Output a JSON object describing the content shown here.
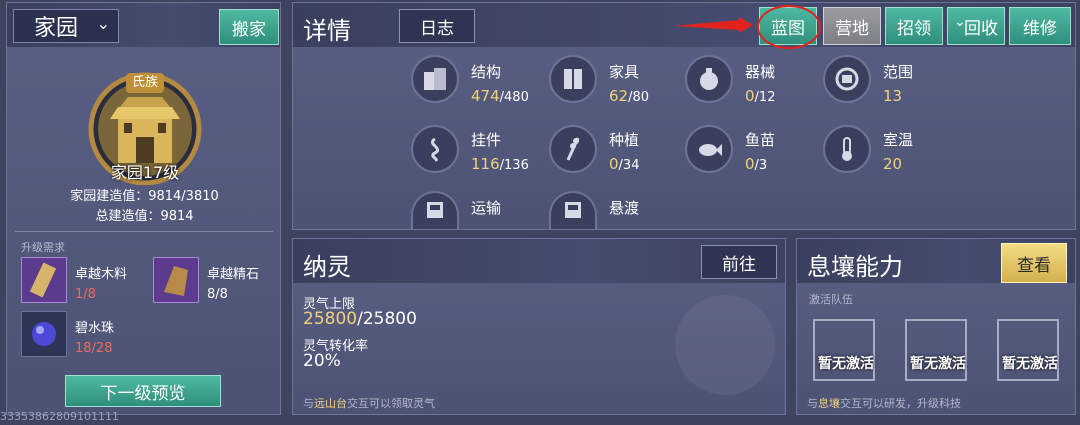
{
  "home": {
    "title": "家园",
    "move_button": "搬家",
    "clan_tag": "氏族",
    "level_label": "家园17级",
    "build_value": "家园建造值：9814/3810",
    "total_build": "总建造值：9814",
    "upgrade_req": "升级需求",
    "materials": [
      {
        "name": "卓越木料",
        "count": "1/8",
        "count_color": "#f06a5a"
      },
      {
        "name": "卓越精石",
        "count": "8/8",
        "count_color": "#ffffff"
      },
      {
        "name": "碧水珠",
        "count": "18/28",
        "count_color": "#f06a5a"
      }
    ],
    "next_preview_button": "下一级预览",
    "footer_digits": "33353862809101111"
  },
  "details": {
    "title": "详情",
    "log_button": "日志",
    "tabs": [
      "蓝图",
      "营地",
      "招领",
      "回收",
      "维修"
    ],
    "stats": [
      {
        "label": "结构",
        "value": "474",
        "total": "/480",
        "icon": "building-icon"
      },
      {
        "label": "家具",
        "value": "62",
        "total": "/80",
        "icon": "wardrobe-icon"
      },
      {
        "label": "器械",
        "value": "0",
        "total": "/12",
        "icon": "machine-icon"
      },
      {
        "label": "范围",
        "value": "13",
        "total": "",
        "icon": "range-icon"
      },
      {
        "label": "挂件",
        "value": "116",
        "total": "/136",
        "icon": "pendant-icon"
      },
      {
        "label": "种植",
        "value": "0",
        "total": "/34",
        "icon": "wheat-icon"
      },
      {
        "label": "鱼苗",
        "value": "0",
        "total": "/3",
        "icon": "fish-icon"
      },
      {
        "label": "室温",
        "value": "20",
        "total": "",
        "icon": "thermometer-icon"
      },
      {
        "label": "运输",
        "value": "",
        "total": "",
        "icon": "train-icon"
      },
      {
        "label": "悬渡",
        "value": "",
        "total": "",
        "icon": "train-icon"
      }
    ]
  },
  "naling": {
    "title": "纳灵",
    "go_button": "前往",
    "cap_label": "灵气上限",
    "cap_current": "25800",
    "cap_total": "/25800",
    "rate_label": "灵气转化率",
    "rate_value": "20%",
    "hint_prefix": "与",
    "hint_place": "远山台",
    "hint_suffix": "交互可以领取灵气"
  },
  "xirang": {
    "title": "息壤能力",
    "view_button": "查看",
    "team_label": "激活队伍",
    "slots": [
      "暂无激活",
      "暂无激活",
      "暂无激活"
    ],
    "hint_prefix": "与",
    "hint_place": "息壤",
    "hint_suffix": "交互可以研发，升级科技"
  },
  "colors": {
    "accent_gold": "#f1d27a",
    "green_button": "#3aa58e",
    "annotation_red": "#e0231c"
  }
}
